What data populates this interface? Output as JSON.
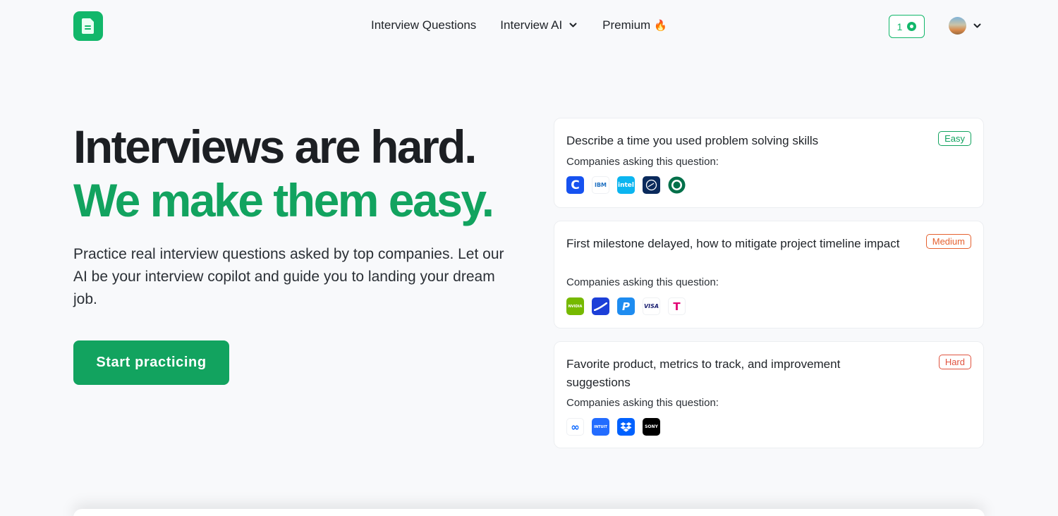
{
  "header": {
    "nav": {
      "questions": "Interview Questions",
      "ai": "Interview AI",
      "premium": "Premium",
      "premium_emoji": "🔥"
    },
    "credits": "1",
    "brand_color": "#12b76a"
  },
  "hero": {
    "title_line1": "Interviews are hard.",
    "title_line2": "We make them easy.",
    "subtitle": "Practice real interview questions asked by top companies. Let our AI be your interview copilot and guide you to landing your dream job.",
    "cta": "Start practicing"
  },
  "questions": [
    {
      "title": "Describe a time you used problem solving skills",
      "difficulty": "Easy",
      "companies_label": "Companies asking this question:",
      "companies": [
        "coinbase-logo",
        "ibm-logo",
        "intel-logo",
        "lufthansa-logo",
        "starbucks-logo"
      ],
      "company_text": [
        "C",
        "IBM",
        "intel",
        "",
        ""
      ]
    },
    {
      "title": "First milestone delayed, how to mitigate project timeline impact",
      "difficulty": "Medium",
      "companies_label": "Companies asking this question:",
      "companies": [
        "nvidia-logo",
        "airline-logo",
        "paypal-logo",
        "visa-logo",
        "t-mobile-logo"
      ],
      "company_text": [
        "NVIDIA",
        "",
        "P",
        "VISA",
        "T"
      ]
    },
    {
      "title": "Favorite product, metrics to track, and improvement suggestions",
      "difficulty": "Hard",
      "companies_label": "Companies asking this question:",
      "companies": [
        "meta-logo",
        "intuit-logo",
        "dropbox-logo",
        "sony-logo"
      ],
      "company_text": [
        "∞",
        "INTUIT",
        "",
        "SONY"
      ]
    }
  ]
}
